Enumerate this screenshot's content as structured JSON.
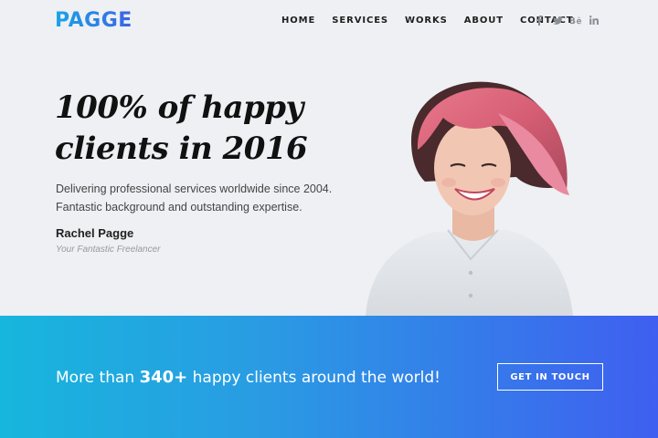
{
  "brand": {
    "logo": "PAGGE"
  },
  "nav": {
    "items": [
      {
        "label": "HOME"
      },
      {
        "label": "SERVICES"
      },
      {
        "label": "WORKS"
      },
      {
        "label": "ABOUT"
      },
      {
        "label": "CONTACT"
      }
    ]
  },
  "social": [
    {
      "icon": "facebook-icon",
      "glyph": "f"
    },
    {
      "icon": "twitter-icon",
      "glyph": "🐦"
    },
    {
      "icon": "behance-icon",
      "glyph": "Bē"
    },
    {
      "icon": "linkedin-icon",
      "glyph": "in"
    }
  ],
  "hero": {
    "headline_line1": "100% of happy",
    "headline_line2": "clients in 2016",
    "desc_line1": "Delivering professional services worldwide since 2004.",
    "desc_line2": "Fantastic background and outstanding expertise.",
    "name": "Rachel Pagge",
    "role": "Your Fantastic Freelancer"
  },
  "band": {
    "text_before": "More than ",
    "highlight": "340+",
    "text_after": " happy clients around the world!",
    "button_label": "GET IN TOUCH"
  },
  "colors": {
    "accent_start": "#17b6dd",
    "accent_end": "#3f5ff0",
    "background": "#eef0f3"
  }
}
